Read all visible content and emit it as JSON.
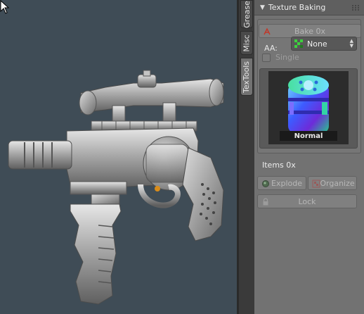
{
  "viewport": {
    "subject_icon": "revolver-with-scope-model"
  },
  "tabs": [
    {
      "label": "Grease",
      "active": false
    },
    {
      "label": "Misc",
      "active": false
    },
    {
      "label": "TexTools",
      "active": true
    }
  ],
  "panel": {
    "title": "Texture Baking",
    "bake_button": {
      "label": "Bake 0x",
      "icon": "bake-icon"
    },
    "aa": {
      "label": "AA:",
      "value": "None",
      "icon": "checker-icon"
    },
    "single": {
      "label": "Single",
      "checked": false
    },
    "preview": {
      "caption": "Normal"
    },
    "items_count": "Items 0x",
    "explode_button": {
      "label": "Explode",
      "icon": "explode-icon"
    },
    "organize_button": {
      "label": "Organize",
      "icon": "organize-icon"
    },
    "lock_button": {
      "label": "Lock",
      "icon": "lock-icon"
    }
  },
  "colors": {
    "viewport_bg": "#3f4c56",
    "panel_bg": "#727272",
    "bake_icon": "#c0392b",
    "aa_icon": "#3dd13d"
  }
}
